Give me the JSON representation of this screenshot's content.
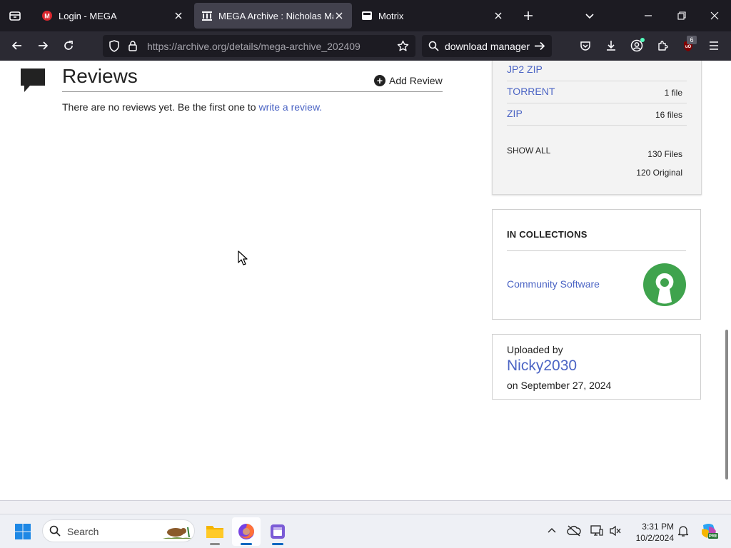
{
  "browser": {
    "tabs": [
      {
        "title": "Login - MEGA",
        "active": false
      },
      {
        "title": "MEGA Archive : Nicholas Martin",
        "active": true
      },
      {
        "title": "Motrix",
        "active": false
      }
    ],
    "url_host": "https://archive.org",
    "url_path": "/details/mega-archive_202409",
    "search_text": "download manager",
    "extension_badge": "6"
  },
  "reviews": {
    "title": "Reviews",
    "add_review": "Add Review",
    "empty_text": "There are no reviews yet. Be the first one to ",
    "empty_link": "write a review."
  },
  "downloads": {
    "rows": [
      {
        "format": "JP2 ZIP",
        "count": ""
      },
      {
        "format": "TORRENT",
        "count": "1 file"
      },
      {
        "format": "ZIP",
        "count": "16 files"
      }
    ],
    "show_all": "SHOW ALL",
    "total_files": "130 Files",
    "original_files": "120 Original"
  },
  "collections": {
    "title": "IN COLLECTIONS",
    "item": "Community Software"
  },
  "uploader": {
    "label": "Uploaded by",
    "name": "Nicky2030",
    "date": "on September 27, 2024"
  },
  "taskbar": {
    "search_placeholder": "Search",
    "time": "3:31 PM",
    "date": "10/2/2024"
  },
  "colors": {
    "link": "#4b64c4",
    "chrome_dark": "#1c1b22",
    "toolbar": "#2b2a33",
    "mega_red": "#d9272e",
    "collection_green": "#3fa34d"
  }
}
